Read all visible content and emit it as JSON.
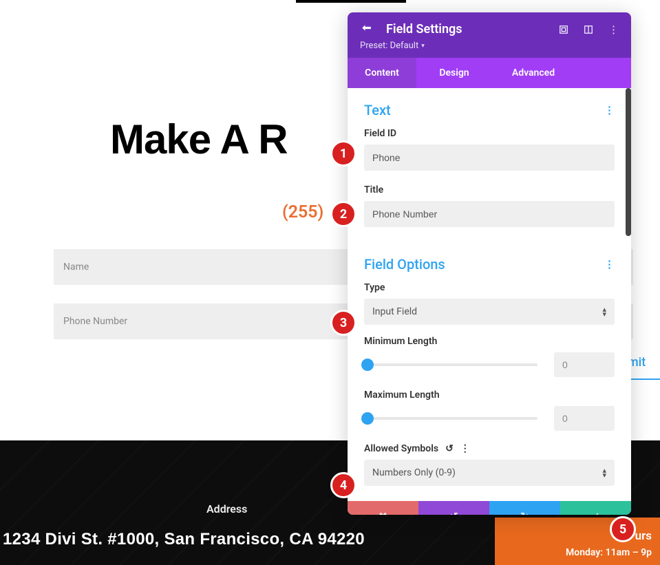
{
  "page": {
    "heading": "Make A R",
    "phone_partial": "(255)",
    "input_name_ph": "Name",
    "input_phone_ph": "Phone Number",
    "submit_partial": "mit",
    "address_label": "Address",
    "address_text": "1234 Divi St. #1000, San Francisco, CA 94220",
    "hours_partial_1": "urs",
    "hours_partial_2": "Monday: 11am – 9p"
  },
  "panel": {
    "title": "Field Settings",
    "preset_label": "Preset: Default",
    "tabs": {
      "content": "Content",
      "design": "Design",
      "advanced": "Advanced"
    },
    "sections": {
      "text": {
        "title": "Text",
        "field_id_label": "Field ID",
        "field_id_value": "Phone",
        "title_label": "Title",
        "title_value": "Phone Number"
      },
      "options": {
        "title": "Field Options",
        "type_label": "Type",
        "type_value": "Input Field",
        "min_label": "Minimum Length",
        "min_value": "0",
        "max_label": "Maximum Length",
        "max_value": "0",
        "allowed_label": "Allowed Symbols",
        "allowed_value": "Numbers Only (0-9)"
      }
    }
  },
  "circles": {
    "c1": "1",
    "c2": "2",
    "c3": "3",
    "c4": "4",
    "c5": "5"
  },
  "icons": {
    "back": "↶",
    "expand": "⛶",
    "split": "▥",
    "more": "⋮",
    "reset": "↺",
    "cancel": "✖",
    "undo": "↺",
    "redo": "↻",
    "check": "✓",
    "caret_up": "▴",
    "caret_down": "▾"
  }
}
